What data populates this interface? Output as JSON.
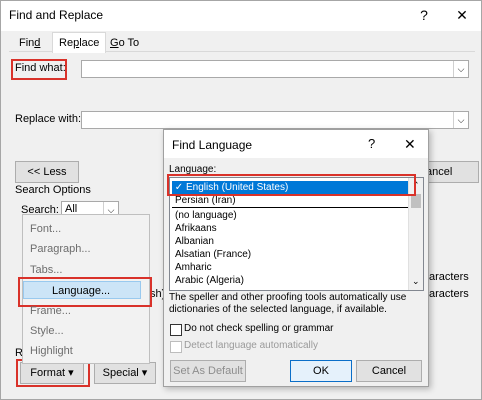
{
  "main_dialog": {
    "title": "Find and Replace",
    "help": "?",
    "close": "✕",
    "tabs": [
      {
        "prefix": "Fin",
        "u": "d",
        "suffix": ""
      },
      {
        "prefix": "Re",
        "u": "p",
        "suffix": "lace"
      },
      {
        "prefix": "",
        "u": "G",
        "suffix": "o To"
      }
    ],
    "find_label": "Find what:",
    "replace_label": "Replace with:",
    "less_button": "<< Less",
    "cancel_partial": "ancel",
    "search_options": "Search Options",
    "search_label": "Search:",
    "search_value": "All",
    "partial_sh": "sh)",
    "partial_re": "Re",
    "right_partial_1": "aracters",
    "right_partial_2": "aracters",
    "format_button": "Format ▾",
    "special_button": "Special ▾"
  },
  "format_menu": {
    "items": [
      "Font...",
      "Paragraph...",
      "Tabs...",
      "Language...",
      "Frame...",
      "Style...",
      "Highlight"
    ]
  },
  "find_language": {
    "title": "Find Language",
    "help": "?",
    "close": "✕",
    "language_label": "Language:",
    "languages": [
      "English (United States)",
      "Persian (Iran)",
      "(no language)",
      "Afrikaans",
      "Albanian",
      "Alsatian (France)",
      "Amharic",
      "Arabic (Algeria)"
    ],
    "note": "The speller and other proofing tools automatically use dictionaries of the selected language, if available.",
    "do_not_check": "Do not check spelling or grammar",
    "detect": "Detect language automatically",
    "set_default": "Set As Default",
    "ok": "OK",
    "cancel": "Cancel"
  }
}
